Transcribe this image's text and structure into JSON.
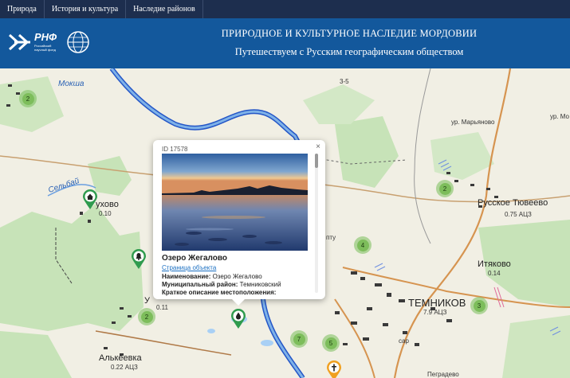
{
  "nav": {
    "items": [
      {
        "label": "Природа"
      },
      {
        "label": "История и культура"
      },
      {
        "label": "Наследие районов"
      }
    ]
  },
  "header": {
    "logo_rnf": "РНФ",
    "logo_rnf_sub": "Российский научный фонд",
    "title_line1": "ПРИРОДНОЕ И КУЛЬТУРНОЕ НАСЛЕДИЕ МОРДОВИИ",
    "title_line2": "Путешествуем с Русским географическим обществом"
  },
  "map": {
    "places": [
      {
        "text": "Мокша",
        "kind": "river"
      },
      {
        "text": "ур. Марьяново",
        "kind": "small"
      },
      {
        "text": "ур. Мо",
        "kind": "small"
      },
      {
        "text": "Русское Тювеево",
        "kind": "normal"
      },
      {
        "text": "0.75 АЦЗ",
        "kind": "small"
      },
      {
        "text": "Итяково",
        "kind": "normal"
      },
      {
        "text": "0.14",
        "kind": "small"
      },
      {
        "text": "ТЕМНИКОВ",
        "kind": "big"
      },
      {
        "text": "7.9 АЦЗ",
        "kind": "small"
      },
      {
        "text": "ухово",
        "kind": "normal"
      },
      {
        "text": "0.10",
        "kind": "small"
      },
      {
        "text": "Алькеевка",
        "kind": "normal"
      },
      {
        "text": "0.22 АЦЗ",
        "kind": "small"
      },
      {
        "text": "Сельбай",
        "kind": "river"
      },
      {
        "text": "У",
        "kind": "normal"
      },
      {
        "text": "0.11",
        "kind": "small"
      },
      {
        "text": "Пеградево",
        "kind": "small"
      },
      {
        "text": "сар",
        "kind": "small"
      },
      {
        "text": "пту",
        "kind": "small"
      },
      {
        "text": "3-5",
        "kind": "small"
      }
    ],
    "clusters": [
      {
        "count": "2"
      },
      {
        "count": "2"
      },
      {
        "count": "4"
      },
      {
        "count": "3"
      },
      {
        "count": "2"
      },
      {
        "count": "7"
      },
      {
        "count": "5"
      }
    ]
  },
  "popup": {
    "id_text": "ID 17578",
    "close": "×",
    "name": "Озеро Жегалово",
    "link": "Страница объекта",
    "fields": [
      {
        "label": "Наименование:",
        "value": " Озеро Жегалово"
      },
      {
        "label": "Муниципальный район:",
        "value": " Темниковский"
      },
      {
        "label": "Краткое описание местоположения:",
        "value": ""
      }
    ]
  }
}
